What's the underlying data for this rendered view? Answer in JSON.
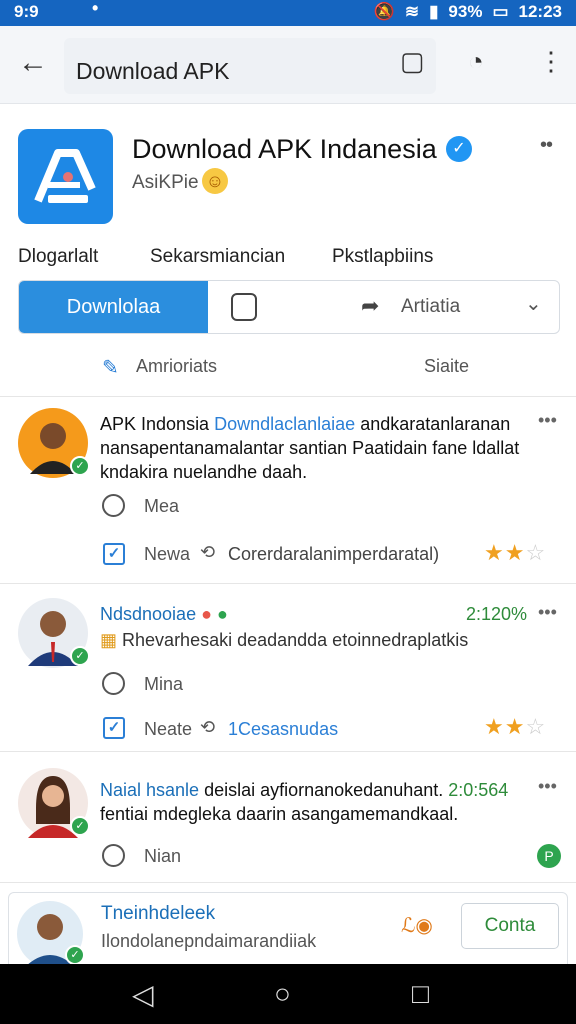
{
  "status": {
    "time": "9:9",
    "battery": "93%",
    "clock": "12:23",
    "icons": [
      "mute-icon",
      "wifi-icon",
      "signal-icon",
      "battery-icon"
    ]
  },
  "appbar": {
    "title": "Download APK",
    "icons": [
      "back-icon",
      "bookmark-icon",
      "history-icon",
      "more-icon"
    ]
  },
  "header": {
    "title": "Download APK Indanesia",
    "subtitle": "AsiKPie",
    "logo": "apk-logo-icon"
  },
  "tabs": [
    "Dlogarlalt",
    "Sekarsmiancian",
    "Pkstlapbiins"
  ],
  "actions": {
    "download": "Downlolaa",
    "share": "Artiatia"
  },
  "subrow": {
    "left": "Amrioriats",
    "right": "Siaite"
  },
  "posts": [
    {
      "author": "APK Indonsia",
      "link": "Downdlaclanlaiae",
      "text1": " andkaratanlaranan",
      "text2": "nansapentanamalantar santian Paatidain fane ldallat",
      "text3": "kndakira nuelandhe daah.",
      "like": "Mea",
      "share_left": "Newa",
      "share_right": "Corerdaralanimperdaratal)",
      "stars": 2
    },
    {
      "author": "Ndsdnooiae",
      "time": "2:120%",
      "text1": "Rhevarhesaki deadandda etoinnedraplatkis",
      "like": "Mina",
      "share_left": "Neate",
      "share_right": "1Cesasnudas",
      "stars": 2
    },
    {
      "author": "Naial hsanle",
      "text1": " deislai ayfiornanokedanuhant.",
      "time": "2:0:564",
      "text2": "fentiai mdegleka daarin asangamemandkaal.",
      "like": "Nian"
    }
  ],
  "bottom": {
    "name": "Tneinhdeleek",
    "sub": "Ilondolanepndaimarandiiak",
    "button": "Conta"
  },
  "colors": {
    "brand": "#1565c0",
    "accent": "#2b8ede",
    "star": "#f0a020"
  }
}
